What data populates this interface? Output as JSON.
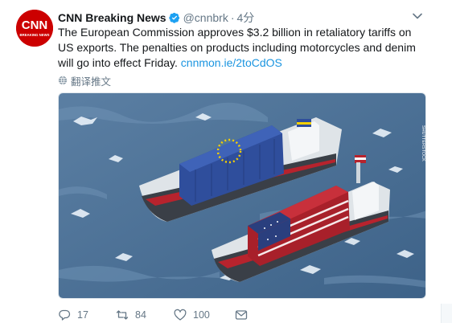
{
  "tweet": {
    "author_name": "CNN Breaking News",
    "handle": "@cnnbrk",
    "separator": "·",
    "time": "4分",
    "avatar_text_top": "CNN",
    "avatar_text_bottom": "BREAKING NEWS",
    "text_main": "The European Commission approves $3.2 billion in retaliatory tariffs on US exports. The penalties on products including motorcycles and denim will go into effect Friday. ",
    "text_link": "cnnmon.ie/2toCdOS",
    "translate_label": "翻译推文",
    "image_credit": "SHUTTERSTOCK",
    "actions": {
      "replies": "17",
      "retweets": "84",
      "likes": "100"
    },
    "icons": [
      "verified-badge-icon",
      "chevron-down-icon",
      "globe-icon",
      "reply-icon",
      "retweet-icon",
      "like-icon",
      "message-icon"
    ],
    "colors": {
      "brand_red": "#cc0000",
      "link_blue": "#1b95e0",
      "muted": "#657786",
      "verified_blue": "#1da1f2",
      "sea": "#4a6f93"
    }
  }
}
